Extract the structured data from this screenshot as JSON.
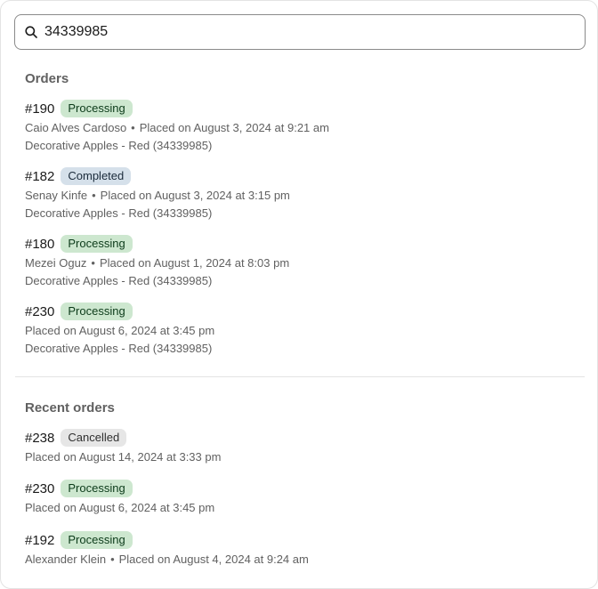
{
  "search": {
    "value": "34339985"
  },
  "orders_section": {
    "title": "Orders",
    "items": [
      {
        "number": "#190",
        "status": "Processing",
        "status_class": "processing",
        "customer": "Caio Alves Cardoso",
        "placed": "Placed on August 3, 2024 at 9:21 am",
        "product": "Decorative Apples - Red (34339985)"
      },
      {
        "number": "#182",
        "status": "Completed",
        "status_class": "completed",
        "customer": "Senay Kinfe",
        "placed": "Placed on August 3, 2024 at 3:15 pm",
        "product": "Decorative Apples - Red (34339985)"
      },
      {
        "number": "#180",
        "status": "Processing",
        "status_class": "processing",
        "customer": "Mezei Oguz",
        "placed": "Placed on August 1, 2024 at 8:03 pm",
        "product": "Decorative Apples - Red (34339985)"
      },
      {
        "number": "#230",
        "status": "Processing",
        "status_class": "processing",
        "customer": "",
        "placed": "Placed on August 6, 2024 at 3:45 pm",
        "product": "Decorative Apples - Red (34339985)"
      }
    ]
  },
  "recent_section": {
    "title": "Recent orders",
    "items": [
      {
        "number": "#238",
        "status": "Cancelled",
        "status_class": "cancelled",
        "customer": "",
        "placed": "Placed on August 14, 2024 at 3:33 pm"
      },
      {
        "number": "#230",
        "status": "Processing",
        "status_class": "processing",
        "customer": "",
        "placed": "Placed on August 6, 2024 at 3:45 pm"
      },
      {
        "number": "#192",
        "status": "Processing",
        "status_class": "processing",
        "customer": "Alexander Klein",
        "placed": "Placed on August 4, 2024 at 9:24 am"
      }
    ]
  },
  "separator": "•"
}
